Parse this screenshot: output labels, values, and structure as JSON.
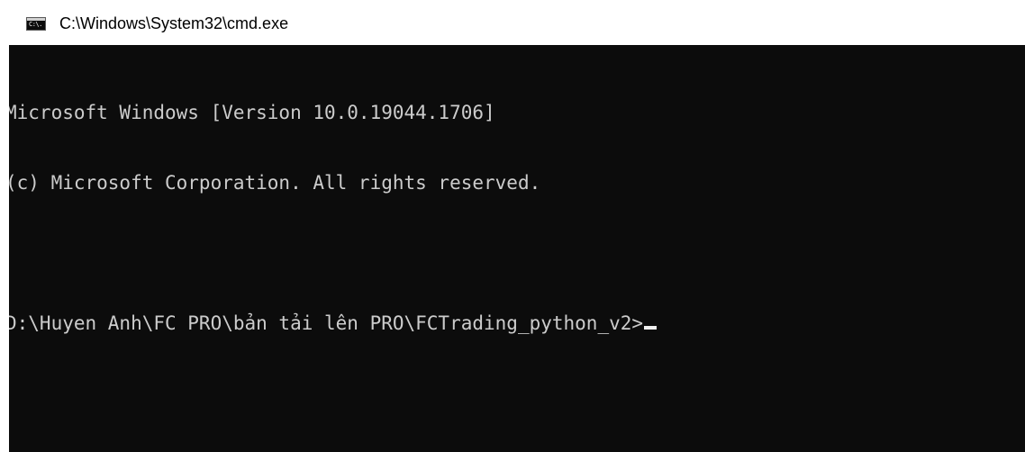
{
  "window": {
    "title": "C:\\Windows\\System32\\cmd.exe",
    "icon": "cmd-console-icon",
    "icon_text": "C:\\."
  },
  "console": {
    "background": "#0c0c0c",
    "foreground": "#cccccc",
    "lines": [
      "Microsoft Windows [Version 10.0.19044.1706]",
      "(c) Microsoft Corporation. All rights reserved.",
      "",
      ""
    ],
    "prompt": "D:\\Huyen Anh\\FC PRO\\bản tải lên PRO\\FCTrading_python_v2>"
  }
}
